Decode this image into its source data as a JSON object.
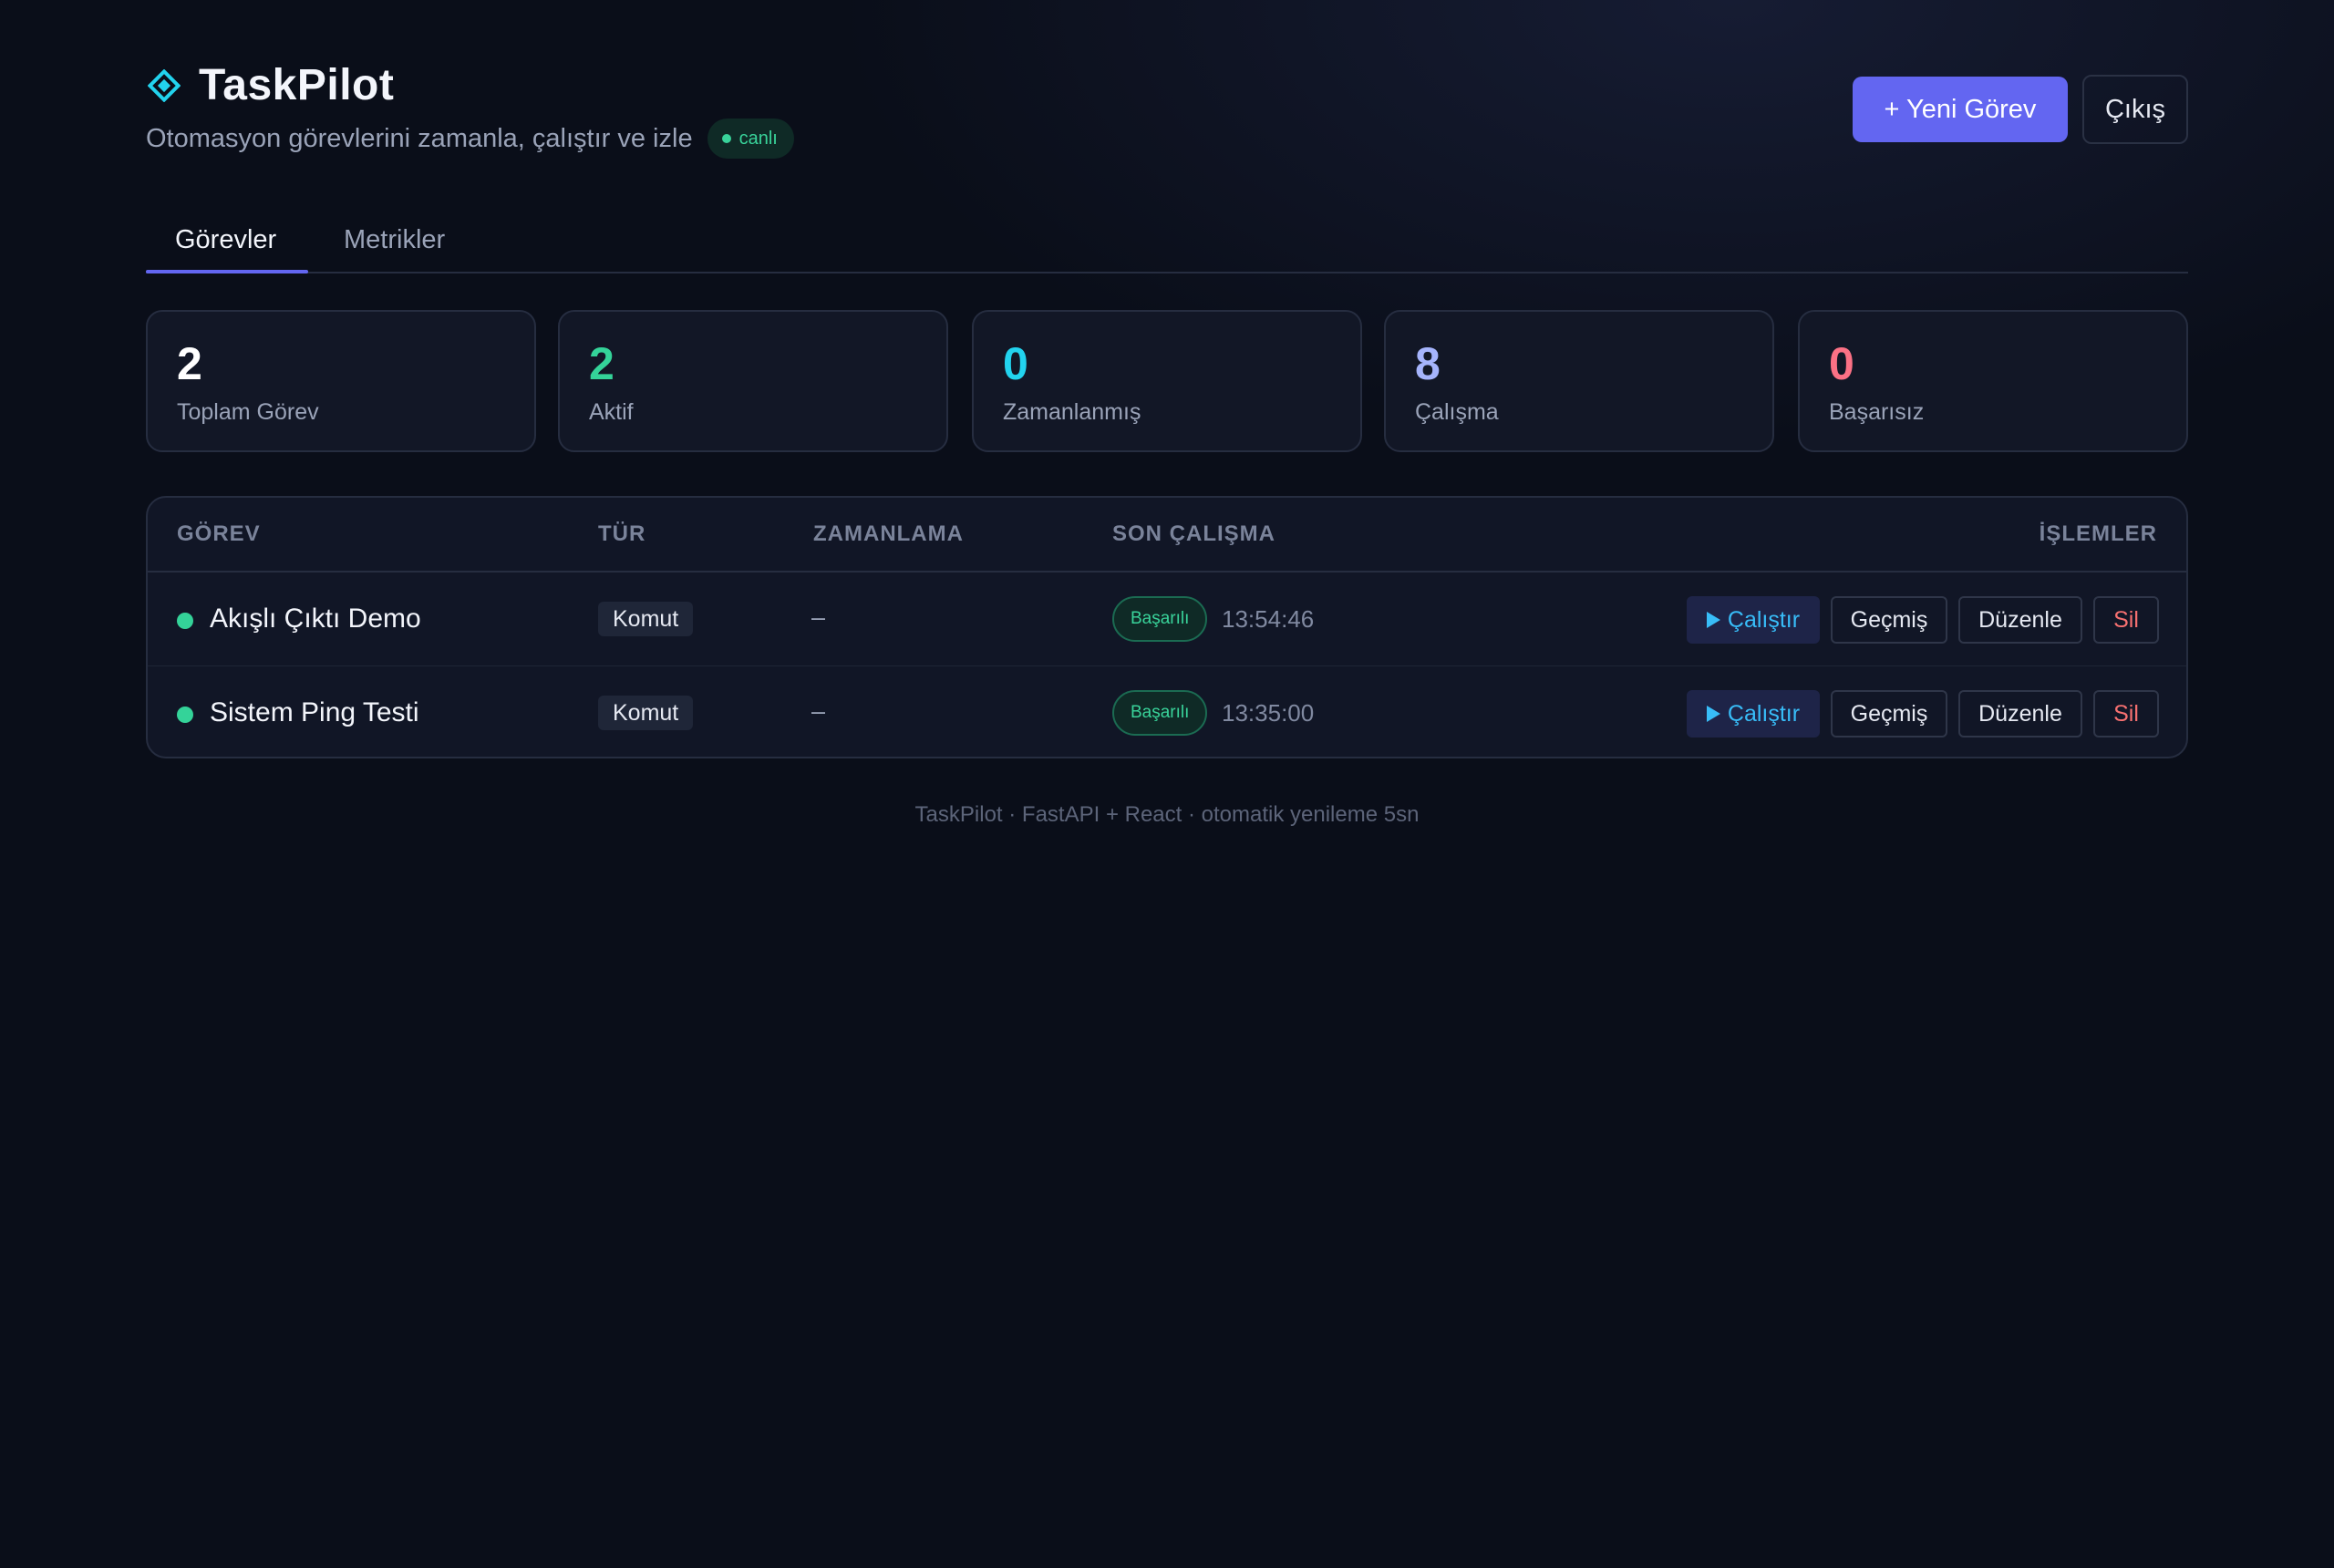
{
  "app": {
    "title": "TaskPilot",
    "subtitle": "Otomasyon görevlerini zamanla, çalıştır ve izle",
    "live_badge": "canlı",
    "brand_icon": "diamond-icon"
  },
  "header": {
    "new_task_label": "+ Yeni Görev",
    "logout_label": "Çıkış"
  },
  "tabs": [
    {
      "label": "Görevler",
      "active": true
    },
    {
      "label": "Metrikler",
      "active": false
    }
  ],
  "stats": [
    {
      "value": "2",
      "label": "Toplam Görev",
      "color": "#ffffff"
    },
    {
      "value": "2",
      "label": "Aktif",
      "color": "#34d399"
    },
    {
      "value": "0",
      "label": "Zamanlanmış",
      "color": "#22d3ee"
    },
    {
      "value": "8",
      "label": "Çalışma",
      "color": "#a5b4fc"
    },
    {
      "value": "0",
      "label": "Başarısız",
      "color": "#fb7185"
    }
  ],
  "table": {
    "columns": [
      "GÖREV",
      "TÜR",
      "ZAMANLAMA",
      "SON ÇALIŞMA",
      "İŞLEMLER"
    ],
    "rows": [
      {
        "name": "Akışlı Çıktı Demo",
        "type": "Komut",
        "schedule": "–",
        "result": "Başarılı",
        "time": "13:54:46"
      },
      {
        "name": "Sistem Ping Testi",
        "type": "Komut",
        "schedule": "–",
        "result": "Başarılı",
        "time": "13:35:00"
      }
    ],
    "actions": {
      "run": "Çalıştır",
      "history": "Geçmiş",
      "edit": "Düzenle",
      "delete": "Sil"
    }
  },
  "footer": "TaskPilot · FastAPI + React · otomatik yenileme 5sn",
  "colors": {
    "accent": "#6366f1",
    "success": "#34d399",
    "run": "#38bdf8",
    "danger": "#f87171"
  }
}
